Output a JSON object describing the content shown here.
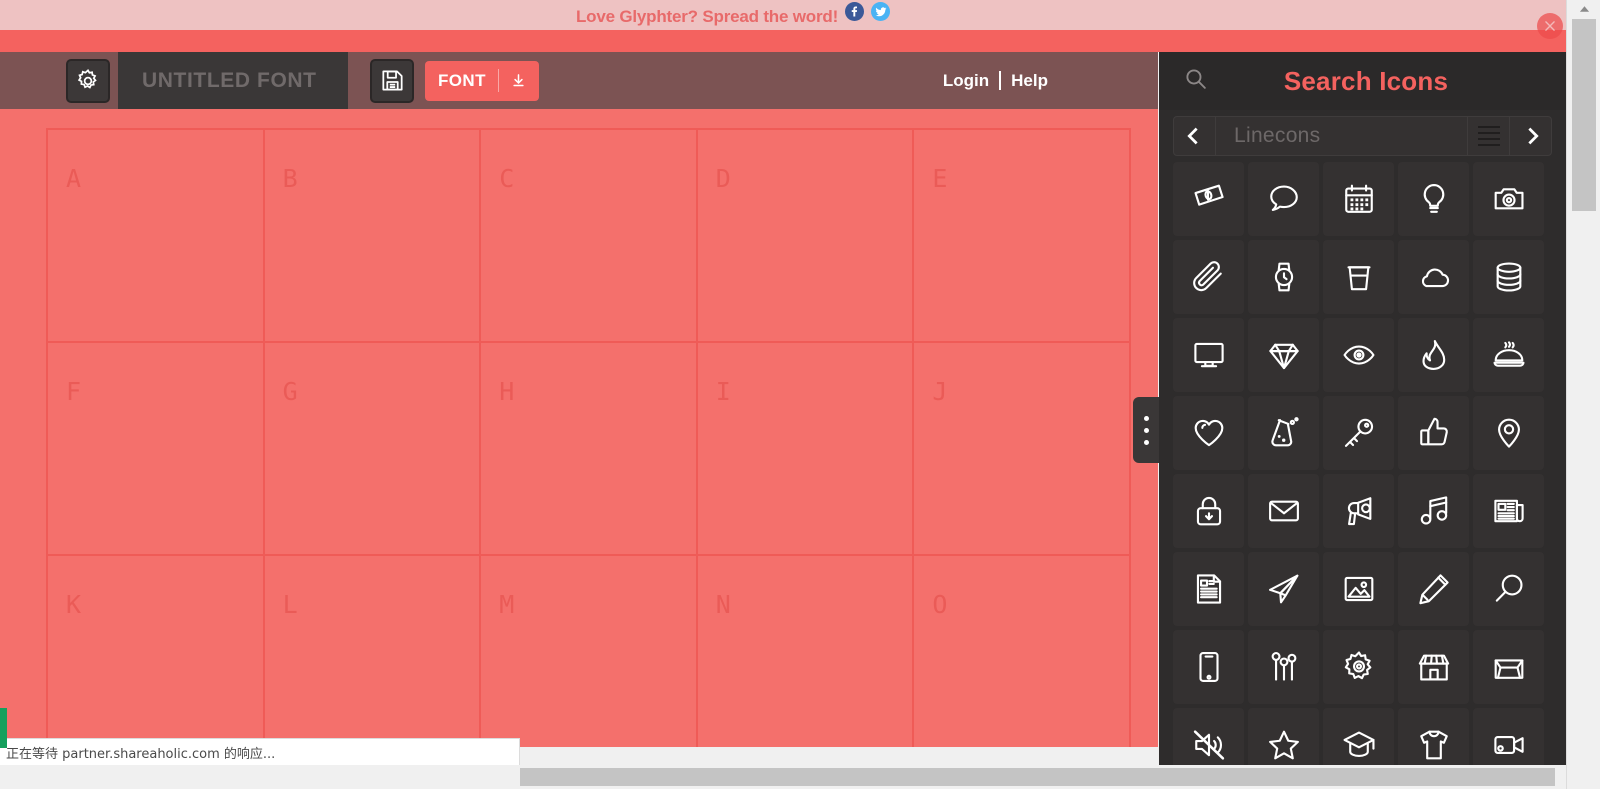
{
  "banner": {
    "text": "Love Glyphter? Spread the word!",
    "facebook_icon": "facebook-icon",
    "twitter_icon": "twitter-icon",
    "close_icon": "close-icon",
    "background": "#eec2c2",
    "text_color": "#e86a6a"
  },
  "toolbar": {
    "settings_icon": "gear-icon",
    "font_name_placeholder": "UNTITLED FONT",
    "font_name_value": "",
    "save_icon": "floppy-disk-icon",
    "download_label": "FONT",
    "download_icon": "download-arrow-icon",
    "login_label": "Login",
    "help_label": "Help",
    "background": "#7c5353",
    "accent": "#f4625f"
  },
  "canvas": {
    "background": "#f4706c",
    "grid_line_color": "#ef5b57",
    "letter_color": "#ea5b57",
    "rows": [
      [
        "A",
        "B",
        "C",
        "D",
        "E"
      ],
      [
        "F",
        "G",
        "H",
        "I",
        "J"
      ],
      [
        "K",
        "L",
        "M",
        "N",
        "O"
      ]
    ]
  },
  "drag_handle": {
    "name": "panel-resize-handle",
    "dots": 3
  },
  "panel": {
    "background": "#2e2c2c",
    "search": {
      "icon": "search-icon",
      "placeholder": "Search Icons",
      "value": "",
      "color": "#f4625f"
    },
    "set_picker": {
      "prev_icon": "chevron-left-icon",
      "next_icon": "chevron-right-icon",
      "list_icon": "hamburger-list-icon",
      "set_name": "Linecons"
    },
    "icon_grid": {
      "columns": 5,
      "cell_bg": "#343131",
      "icons": [
        "money-icon",
        "comment-icon",
        "calendar-icon",
        "lightbulb-icon",
        "camera-icon",
        "paperclip-icon",
        "watch-icon",
        "coffee-cup-icon",
        "cloud-icon",
        "database-icon",
        "desktop-icon",
        "diamond-icon",
        "eye-icon",
        "fire-icon",
        "food-icon",
        "heart-icon",
        "flask-icon",
        "key-icon",
        "thumbs-up-icon",
        "location-pin-icon",
        "lock-icon",
        "envelope-icon",
        "megaphone-icon",
        "music-note-icon",
        "newspaper-icon",
        "document-icon",
        "paper-plane-icon",
        "photo-icon",
        "pencil-icon",
        "magnifier-icon",
        "tablet-icon",
        "sliders-icon",
        "cog-icon",
        "shop-icon",
        "inbox-icon",
        "mute-icon",
        "star-icon",
        "graduation-cap-icon",
        "tshirt-icon",
        "video-camera-icon"
      ]
    }
  },
  "browser": {
    "status_text": "正在等待 partner.shareaholic.com 的响应...",
    "vertical_scrollbar": "vertical-scrollbar",
    "horizontal_scrollbar": "horizontal-scrollbar"
  }
}
